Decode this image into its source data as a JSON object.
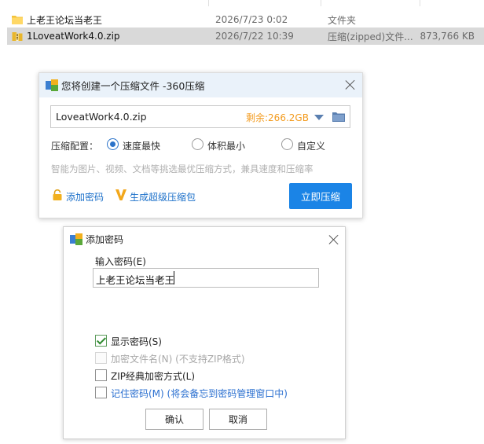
{
  "files": [
    {
      "name": "上老王论坛当老王",
      "date": "2026/7/23 0:02",
      "type": "文件夹",
      "size": "",
      "icon": "folder-icon",
      "selected": false
    },
    {
      "name": "1LoveatWork4.0.zip",
      "date": "2026/7/22 10:39",
      "type": "压缩(zipped)文件...",
      "size": "873,766 KB",
      "icon": "zip-file-icon",
      "selected": true
    }
  ],
  "compress_dialog": {
    "title": "您将创建一个压缩文件 -360压缩",
    "path_value": "LoveatWork4.0.zip",
    "space_left": "剩余:266.2GB",
    "config_label": "压缩配置：",
    "options": [
      "速度最快",
      "体积最小",
      "自定义"
    ],
    "selected_option": "速度最快",
    "hint": "智能为图片、视频、文档等挑选最优压缩方式，兼具速度和压缩率",
    "add_password": "添加密码",
    "super_package": "生成超级压缩包",
    "compress_now": "立即压缩"
  },
  "password_dialog": {
    "title": "添加密码",
    "input_label": "输入密码(E)",
    "input_value": "上老王论坛当老王",
    "checkboxes": [
      {
        "label": "显示密码(S)",
        "checked": true,
        "disabled": false
      },
      {
        "label": "加密文件名(N) (不支持ZIP格式)",
        "checked": false,
        "disabled": true
      },
      {
        "label": "ZIP经典加密方式(L)",
        "checked": false,
        "disabled": false
      },
      {
        "label": "记住密码(M) (将会备忘到密码管理窗口中)",
        "checked": false,
        "disabled": false
      }
    ],
    "ok": "确认",
    "cancel": "取消"
  },
  "colors": {
    "accent": "#1b84e6",
    "space_text": "#f39b1e",
    "link": "#1a6fc9"
  }
}
